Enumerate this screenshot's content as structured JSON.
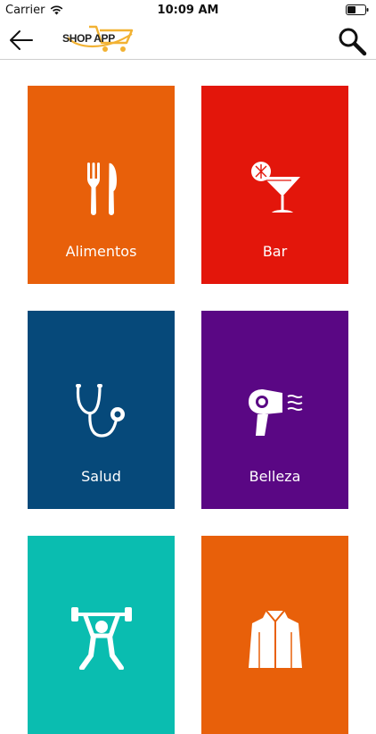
{
  "status_bar": {
    "carrier": "Carrier",
    "time": "10:09 AM"
  },
  "header": {
    "logo_text": "SHOP APP",
    "brand_accent": "#F2B233"
  },
  "categories": [
    {
      "label": "Alimentos",
      "color": "#E8600A",
      "icon": "fork-knife-icon"
    },
    {
      "label": "Bar",
      "color": "#E3160B",
      "icon": "cocktail-icon"
    },
    {
      "label": "Salud",
      "color": "#06497A",
      "icon": "stethoscope-icon"
    },
    {
      "label": "Belleza",
      "color": "#5A0784",
      "icon": "hair-dryer-icon"
    },
    {
      "label": "",
      "color": "#0ABDB0",
      "icon": "weightlifter-icon"
    },
    {
      "label": "",
      "color": "#E8600A",
      "icon": "jacket-icon"
    }
  ]
}
